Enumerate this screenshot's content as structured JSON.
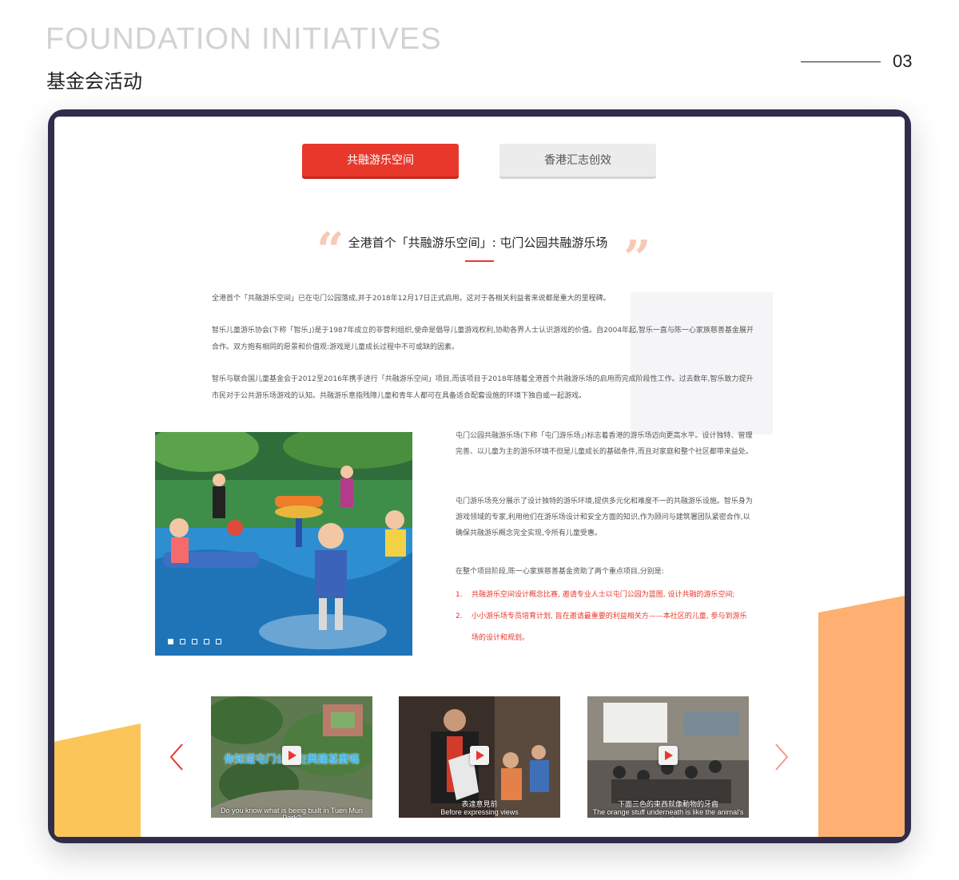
{
  "header": {
    "en_title": "FOUNDATION INITIATIVES",
    "cn_title": "基金会活动",
    "page_number": "03"
  },
  "tabs": [
    {
      "label": "共融游乐空间",
      "active": true
    },
    {
      "label": "香港汇志创效",
      "active": false
    }
  ],
  "article": {
    "headline": "全港首个「共融游乐空间」: 屯门公园共融游乐场",
    "quote_open": "“",
    "quote_close": "”",
    "paragraphs": [
      "全港首个「共融游乐空间」已在屯门公园落成,并于2018年12月17日正式启用。这对于各相关利益者来说都是重大的里程碑。",
      "智乐儿童游乐协会(下称「智乐」)是于1987年成立的非营利组织,使命是倡导儿童游戏权利,协助各界人士认识游戏的价值。自2004年起,智乐一直与陈一心家族慈善基金展开合作。双方抱有相同的愿景和价值观:游戏是儿童成长过程中不可或缺的因素。",
      "智乐与联合国儿童基金会于2012至2016年携手进行「共融游乐空间」项目,而该项目于2018年随着全港首个共融游乐场的启用而完成阶段性工作。过去数年,智乐致力提升市民对于公共游乐场游戏的认知。共融游乐意指残障儿童和青年人都可在具备适合配套设施的环境下独自或一起游戏。"
    ],
    "right_paragraphs": [
      "屯门公园共融游乐场(下称「屯门游乐场」)标志着香港的游乐场迈向更高水平。设计独特、管理完善、以儿童为主的游乐环境不但是儿童成长的基础条件,而且对家庭和整个社区都带来益处。",
      "屯门游乐场充分展示了设计独特的游乐环境,提供多元化和难度不一的共融游乐设施。智乐身为游戏领域的专家,利用他们在游乐场设计和安全方面的知识,作为顾问与建筑署团队紧密合作,以确保共融游乐概念完全实现,令所有儿童受惠。",
      "在整个项目阶段,陈一心家族慈善基金资助了两个重点项目,分别是:"
    ],
    "list": [
      {
        "num": "1.",
        "text": "共融游乐空间设计概念比赛, 邀请专业人士以屯门公园为蓝图, 设计共融的游乐空间;"
      },
      {
        "num": "2.",
        "text": "小小游乐场专员培育计划, 旨在邀请最重要的利益相关方——本社区的儿童, 参与到游乐场的设计和规划。"
      }
    ]
  },
  "slideshow": {
    "count": 5,
    "active_index": 0
  },
  "videos": [
    {
      "title_cn": "你知道屯门公园在興建甚麼嗎",
      "caption_en": "Do you know what is being built in Tuen Mun Park?"
    },
    {
      "caption_cn": "表達意見前",
      "caption_en": "Before expressing views"
    },
    {
      "caption_cn": "下面三色的東西就像動物的牙齒",
      "caption_en": "The orange stuff underneath is like the animal's teeth"
    }
  ],
  "colors": {
    "accent_red": "#e8382c",
    "frame_navy": "#2f2d4a",
    "deco_yellow": "#fbc55a",
    "deco_orange": "#fdb071"
  },
  "icons": [
    "quote-open-icon",
    "quote-close-icon",
    "play-icon",
    "chevron-left-icon",
    "chevron-right-icon"
  ]
}
